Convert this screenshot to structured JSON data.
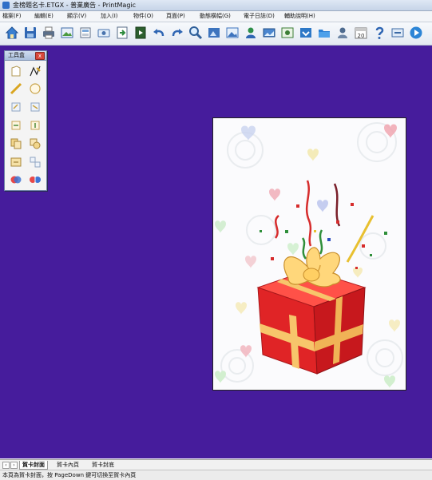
{
  "window": {
    "title": "金榜題名卡.ETGX - 普業廣告 - PrintMagic"
  },
  "menu": [
    "檔案(F)",
    "編輯(E)",
    "顯示(V)",
    "加入(I)",
    "物件(O)",
    "頁面(P)",
    "動態橫幅(G)",
    "電子日誌(D)",
    "輔助說明(H)"
  ],
  "toolbar": {
    "icons": [
      "home-icon",
      "save-icon",
      "print-icon",
      "print-preview-icon",
      "layout-icon",
      "ticket-icon",
      "export-icon",
      "import-icon",
      "undo-icon",
      "redo-icon",
      "zoom-icon",
      "image-edit-icon",
      "picture-icon",
      "user-icon",
      "photo-icon",
      "image-export-icon",
      "folder-icon",
      "person-icon",
      "calendar-icon",
      "help-icon",
      "web-icon",
      "play-icon"
    ],
    "calendar_day": "20"
  },
  "toolbox": {
    "title": "工具盒",
    "close": "x",
    "tools": [
      "page-tool-icon",
      "pen-tool-icon",
      "line-tool-icon",
      "ellipse-tool-icon",
      "rotate-tool-icon",
      "flip-tool-icon",
      "align-left-tool-icon",
      "align-down-tool-icon",
      "copy-tool-icon",
      "shape-tool-icon",
      "group-tool-icon",
      "ungroup-tool-icon",
      "merge-tool-icon",
      "split-tool-icon"
    ]
  },
  "tabs": [
    "賀卡封面",
    "賀卡內頁",
    "賀卡封底"
  ],
  "active_tab": "賀卡封面",
  "status": {
    "text": "本頁為賀卡封面，按 PageDown 鍵可切換至賀卡內頁"
  },
  "colors": {
    "workspace": "#461c9c",
    "card_background": "#fbfbfd",
    "box_red": "#e02426",
    "ribbon": "#f7c56b"
  }
}
